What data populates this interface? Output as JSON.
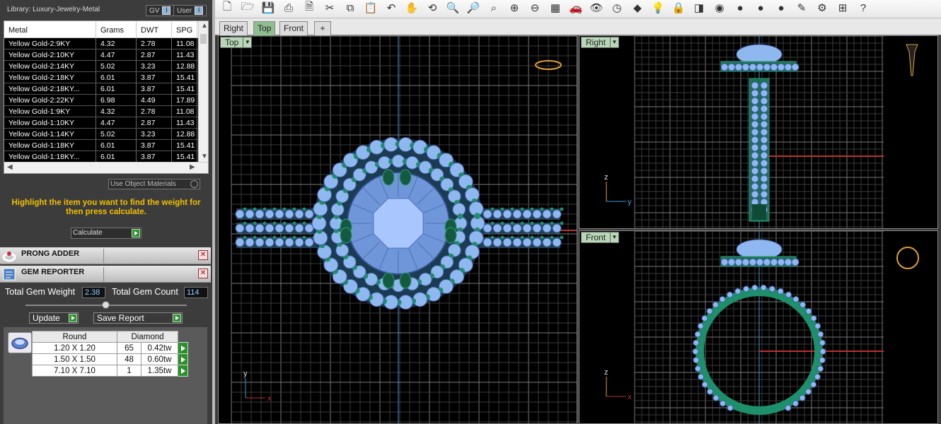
{
  "library": {
    "title": "Library: Luxury-Jewelry-Metal",
    "gv_label": "GV",
    "user_label": "User",
    "columns": [
      "Metal",
      "Grams",
      "DWT",
      "SPG"
    ],
    "rows": [
      [
        "Yellow Gold-2:9KY",
        "4.32",
        "2.78",
        "11.08"
      ],
      [
        "Yellow Gold-2:10KY",
        "4.47",
        "2.87",
        "11.43"
      ],
      [
        "Yellow Gold-2:14KY",
        "5.02",
        "3.23",
        "12.88"
      ],
      [
        "Yellow Gold-2:18KY",
        "6.01",
        "3.87",
        "15.41"
      ],
      [
        "Yellow Gold-2:18KY...",
        "6.01",
        "3.87",
        "15.41"
      ],
      [
        "Yellow Gold-2:22KY",
        "6.98",
        "4.49",
        "17.89"
      ],
      [
        "Yellow Gold-1:9KY",
        "4.32",
        "2.78",
        "11.08"
      ],
      [
        "Yellow Gold-1:10KY",
        "4.47",
        "2.87",
        "11.43"
      ],
      [
        "Yellow Gold-1:14KY",
        "5.02",
        "3.23",
        "12.88"
      ],
      [
        "Yellow Gold-1:18KY",
        "6.01",
        "3.87",
        "15.41"
      ],
      [
        "Yellow Gold-1:18KY...",
        "6.01",
        "3.87",
        "15.41"
      ]
    ],
    "use_object_materials": "Use Object Materials",
    "hint": "Highlight the item you want to find the weight for then press calculate.",
    "calculate_label": "Calculate"
  },
  "panels": {
    "prong_adder": "PRONG ADDER",
    "gem_reporter": "GEM REPORTER"
  },
  "gem_reporter": {
    "total_weight_label": "Total Gem Weight",
    "total_weight_value": "2.38",
    "total_count_label": "Total Gem Count",
    "total_count_value": "114",
    "update_label": "Update",
    "save_report_label": "Save Report",
    "table_header": [
      "Round",
      "Diamond"
    ],
    "table_rows": [
      [
        "1.20 X 1.20",
        "65",
        "0.42tw"
      ],
      [
        "1.50 X 1.50",
        "48",
        "0.60tw"
      ],
      [
        "7.10 X 7.10",
        "1",
        "1.35tw"
      ]
    ]
  },
  "toolbar": {
    "icons": [
      "new-file-icon",
      "open-folder-icon",
      "save-icon",
      "print-icon",
      "page-icon",
      "cut-icon",
      "copy-icon",
      "paste-icon",
      "undo-icon",
      "pan-hand-icon",
      "rotate-view-icon",
      "zoom-icon",
      "zoom-window-icon",
      "zoom-extents-icon",
      "zoom-selected-icon",
      "zoom-dynamic-icon",
      "grid-icon",
      "car-icon",
      "eye-icon",
      "clock-icon",
      "shapes-icon",
      "light-bulb-icon",
      "lock-icon",
      "layers-icon",
      "color-wheel-icon",
      "sphere-shaded-icon",
      "sphere-rendered-icon",
      "sphere-blue-icon",
      "pencil-icon",
      "settings-gear-icon",
      "dimension-icon",
      "help-icon"
    ],
    "glyphs": [
      "🗋",
      "🗁",
      "💾",
      "⎙",
      "🗎",
      "✂",
      "⧉",
      "📋",
      "↶",
      "✋",
      "⟲",
      "🔍",
      "🔎",
      "⌕",
      "⊕",
      "⊖",
      "▦",
      "🚗",
      "👁",
      "◷",
      "◆",
      "💡",
      "🔒",
      "◨",
      "◉",
      "●",
      "●",
      "●",
      "✎",
      "⚙",
      "⊞",
      "?"
    ]
  },
  "tabs": [
    "Right",
    "Top",
    "Front",
    "+"
  ],
  "viewports": {
    "top": {
      "label": "Top"
    },
    "right": {
      "label": "Right"
    },
    "front": {
      "label": "Front"
    }
  },
  "axes": {
    "x": "x",
    "y": "y",
    "z": "z"
  },
  "colors": {
    "gem": "#8fb7f0",
    "metal": "#1f8f6a",
    "grid_major": "#777777",
    "grid_minor": "#3a3a3a",
    "accent_yellow": "#f0c000"
  }
}
